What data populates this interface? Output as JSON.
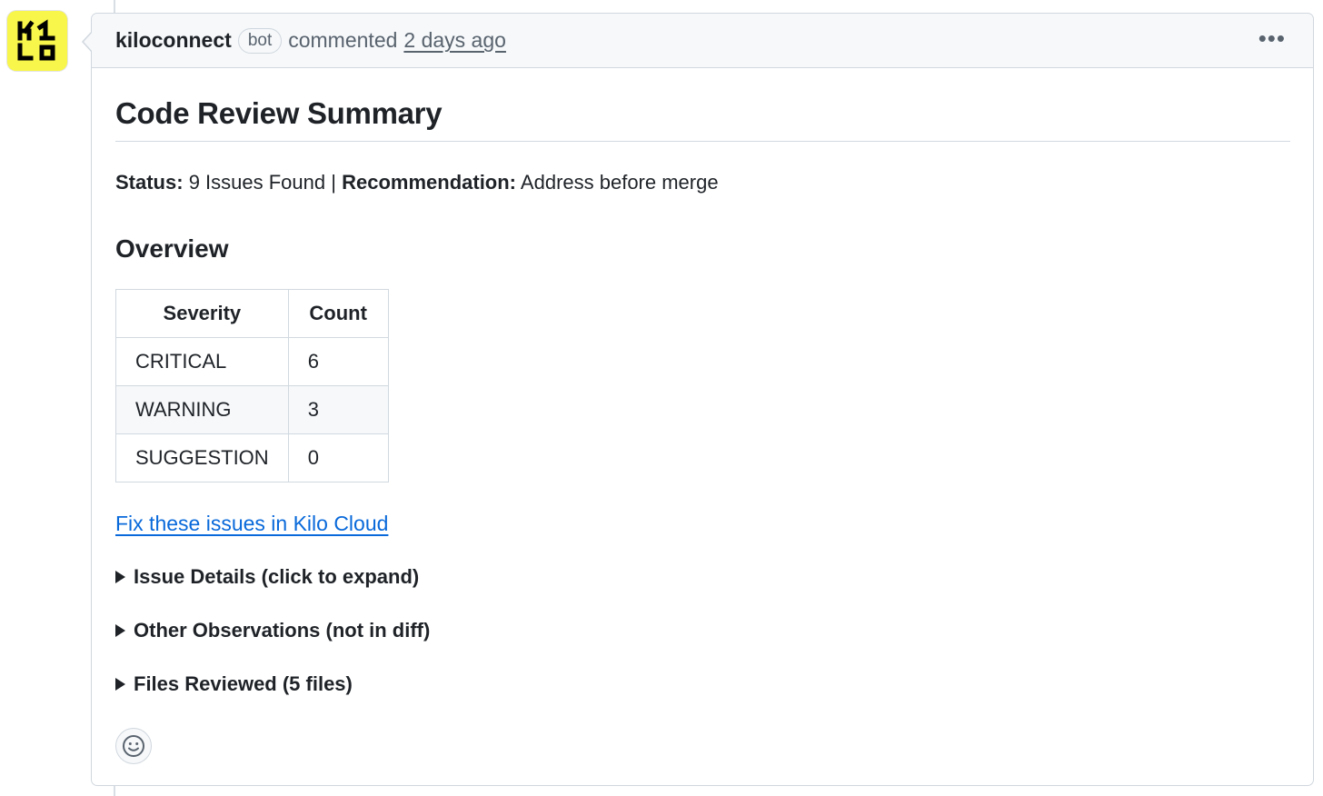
{
  "comment": {
    "author": "kiloconnect",
    "badge": "bot",
    "verb": "commented",
    "timestamp": "2 days ago",
    "menu_icon": "kebab-horizontal-icon",
    "avatar_icon": "kilo-logo-icon",
    "avatar_color": "#f8f64a"
  },
  "review": {
    "title": "Code Review Summary",
    "status_label": "Status:",
    "status_value": "9 Issues Found",
    "separator": "|",
    "recommendation_label": "Recommendation:",
    "recommendation_value": "Address before merge",
    "overview_heading": "Overview",
    "table": {
      "headers": [
        "Severity",
        "Count"
      ],
      "rows": [
        {
          "severity": "CRITICAL",
          "count": "6"
        },
        {
          "severity": "WARNING",
          "count": "3"
        },
        {
          "severity": "SUGGESTION",
          "count": "0"
        }
      ]
    },
    "fix_link": "Fix these issues in Kilo Cloud",
    "details": [
      "Issue Details (click to expand)",
      "Other Observations (not in diff)",
      "Files Reviewed (5 files)"
    ],
    "reaction_icon": "smiley-icon",
    "link_color": "#0969da"
  }
}
